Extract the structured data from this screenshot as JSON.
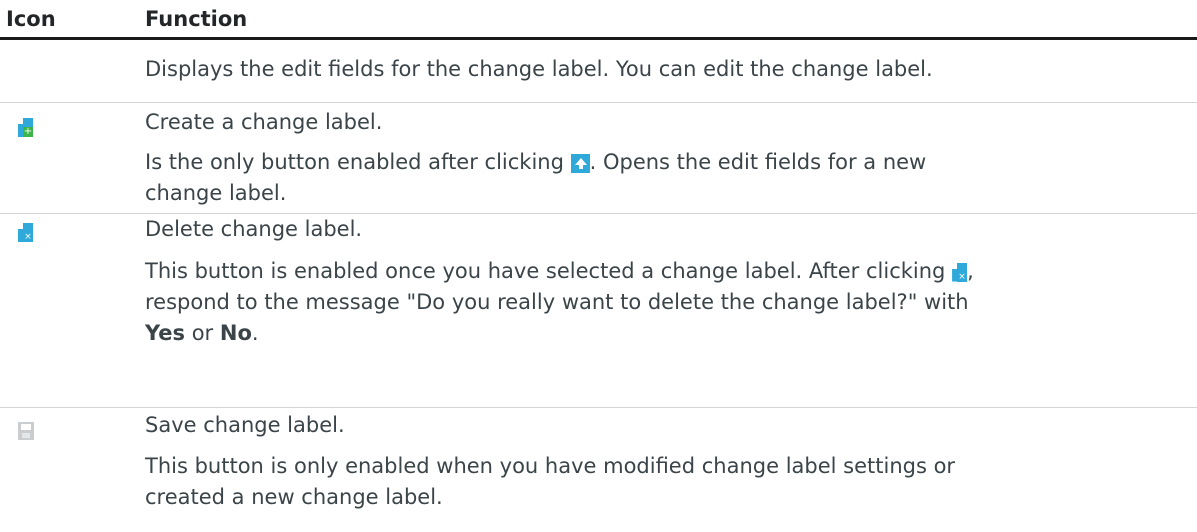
{
  "header": {
    "icon": "Icon",
    "function": "Function"
  },
  "rows": [
    {
      "icon": "",
      "lines": [
        "Displays the edit fields for the change label. You can edit the change label."
      ]
    },
    {
      "icon": "create-change-label-icon",
      "title": "Create a change label.",
      "desc_before": "Is the only button enabled after clicking ",
      "desc_after": ". Opens the edit fields for a new",
      "desc_line2": "change label."
    },
    {
      "icon": "delete-change-label-icon",
      "title": "Delete change label.",
      "desc_line1_before": "This button is enabled once you have selected a change label. After clicking ",
      "desc_line1_after": ",",
      "desc_line2_before": "respond to the message \"Do you really want to delete the change label?\" with",
      "yes": "Yes",
      "or": " or ",
      "no": "No",
      "end": "."
    },
    {
      "icon": "save-change-label-icon",
      "title": "Save change label.",
      "desc_line1": "This button is only enabled when you have modified change label settings or",
      "desc_line2": "created a new change label."
    }
  ],
  "colors": {
    "accent": "#2ea9d9",
    "green": "#3bb54a",
    "text": "#3a4449",
    "rule": "#d4d4d4"
  }
}
